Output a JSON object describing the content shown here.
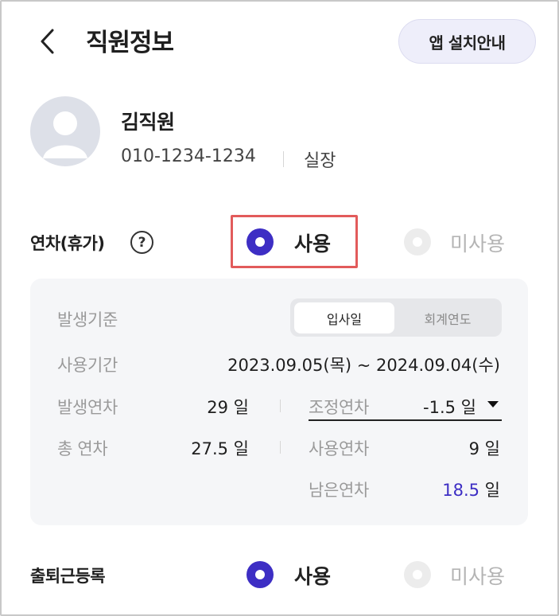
{
  "header": {
    "title": "직원정보",
    "app_install_button": "앱 설치안내"
  },
  "profile": {
    "name": "김직원",
    "phone": "010-1234-1234",
    "position": "실장"
  },
  "annual_leave": {
    "label": "연차(휴가)",
    "help_glyph": "?",
    "option_use": "사용",
    "option_unused": "미사용",
    "selected": "사용",
    "basis_label": "발생기준",
    "basis_options": [
      "입사일",
      "회계연도"
    ],
    "basis_selected": "입사일",
    "period_label": "사용기간",
    "period_value": "2023.09.05(목) ~ 2024.09.04(수)",
    "accrued_label": "발생연차",
    "accrued_value": "29 일",
    "adjust_label": "조정연차",
    "adjust_value": "-1.5 일",
    "total_label": "총 연차",
    "total_value": "27.5 일",
    "used_label": "사용연차",
    "used_value": "9 일",
    "remaining_label": "남은연차",
    "remaining_number": "18.5",
    "remaining_unit": "일"
  },
  "attendance": {
    "label": "출퇴근등록",
    "option_use": "사용",
    "option_unused": "미사용",
    "selected": "사용"
  },
  "colors": {
    "accent": "#3d2ec4",
    "highlight_border": "#e25b5b",
    "panel_bg": "#f5f6f8"
  }
}
